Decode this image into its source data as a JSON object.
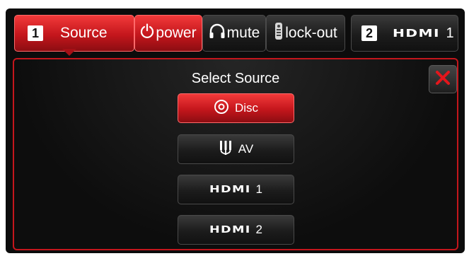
{
  "topbar": {
    "source_tab": {
      "number": "1",
      "label": "Source"
    },
    "power_label": "power",
    "mute_label": "mute",
    "lockout_label": "lock-out",
    "input_tab": {
      "number": "2",
      "logo": "HDMI",
      "number_suffix": "1"
    }
  },
  "panel": {
    "title": "Select Source",
    "close_icon": "close-x-icon",
    "options": [
      {
        "label": "Disc",
        "icon": "disc-icon",
        "selected": true
      },
      {
        "label": "AV",
        "icon": "av-cable-icon",
        "selected": false
      },
      {
        "logo": "HDMI",
        "number": "1",
        "selected": false
      },
      {
        "logo": "HDMI",
        "number": "2",
        "selected": false
      }
    ]
  },
  "colors": {
    "accent_red": "#c4161c",
    "button_dark": "#1c1c1c",
    "text": "#ffffff"
  }
}
